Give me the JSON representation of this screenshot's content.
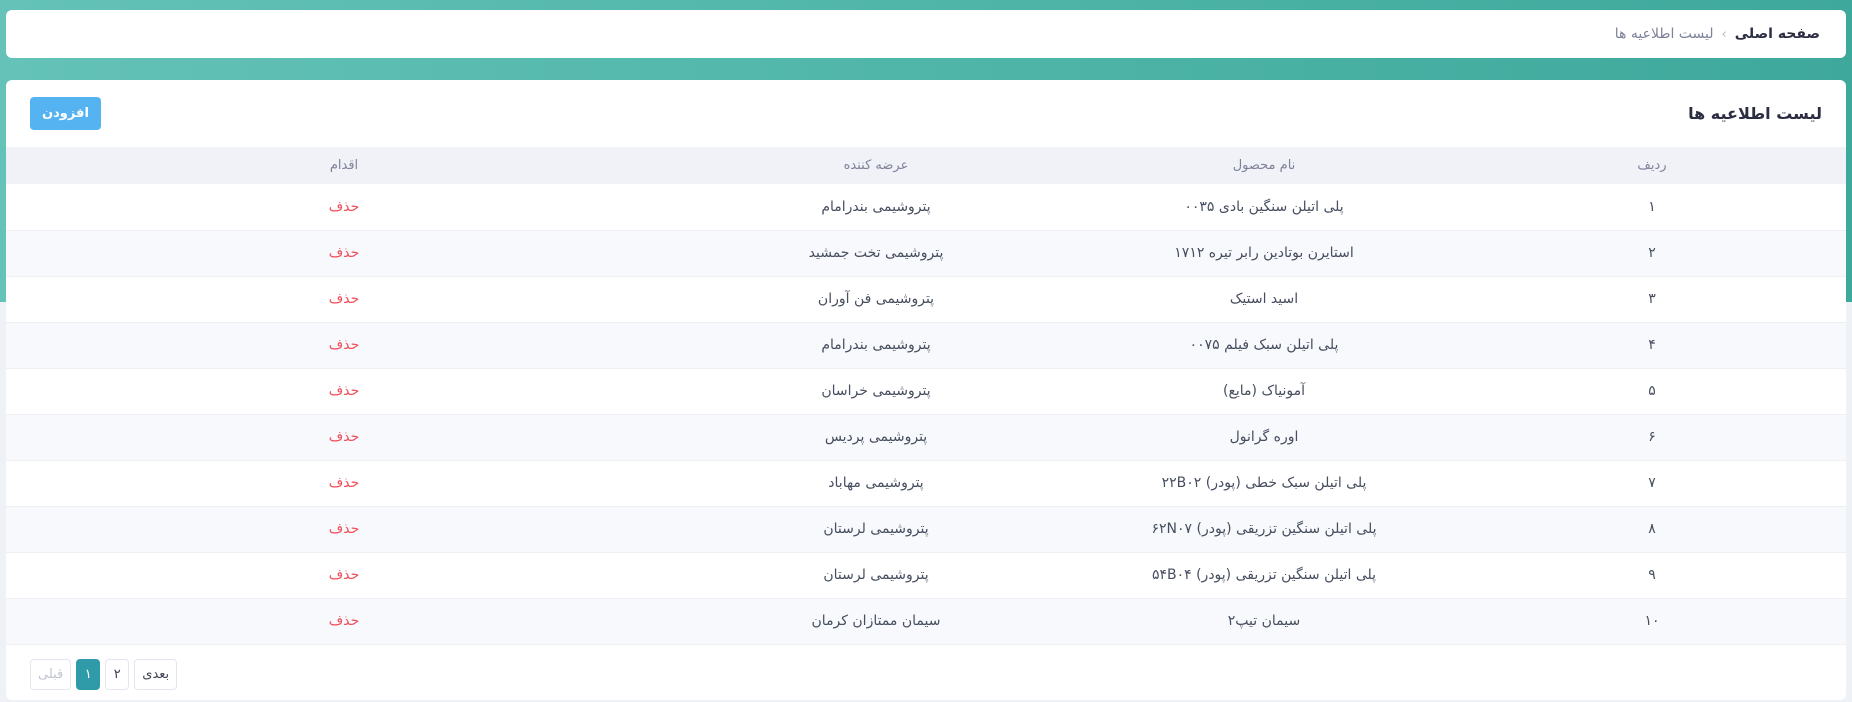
{
  "breadcrumb": {
    "home": "صفحه اصلی",
    "separator": "›",
    "current": "لیست اطلاعیه ها"
  },
  "card": {
    "title": "لیست اطلاعیه ها",
    "add_label": "افزودن"
  },
  "table": {
    "headers": {
      "index": "ردیف",
      "product": "نام محصول",
      "vendor": "عرضه کننده",
      "action": "اقدام"
    },
    "rows": [
      {
        "index": "۱",
        "product": "پلی اتیلن سنگین بادی ۰۰۳۵",
        "vendor": "پتروشیمی بندرامام",
        "action": "حذف"
      },
      {
        "index": "۲",
        "product": "استایرن بوتادین رابر تیره ۱۷۱۲",
        "vendor": "پتروشیمی تخت جمشید",
        "action": "حذف"
      },
      {
        "index": "۳",
        "product": "اسید استیک",
        "vendor": "پتروشیمی فن آوران",
        "action": "حذف"
      },
      {
        "index": "۴",
        "product": "پلی اتیلن سبک فیلم ۰۰۷۵",
        "vendor": "پتروشیمی بندرامام",
        "action": "حذف"
      },
      {
        "index": "۵",
        "product": "آمونیاک (مایع)",
        "vendor": "پتروشیمی خراسان",
        "action": "حذف"
      },
      {
        "index": "۶",
        "product": "اوره گرانول",
        "vendor": "پتروشیمی پردیس",
        "action": "حذف"
      },
      {
        "index": "۷",
        "product": "پلی اتیلن سبک خطی (پودر) ۲۲B۰۲",
        "vendor": "پتروشیمی مهاباد",
        "action": "حذف"
      },
      {
        "index": "۸",
        "product": "پلی اتیلن سنگین تزریقی (پودر) ۶۲N۰۷",
        "vendor": "پتروشیمی لرستان",
        "action": "حذف"
      },
      {
        "index": "۹",
        "product": "پلی اتیلن سنگین تزریقی (پودر) ۵۴B۰۴",
        "vendor": "پتروشیمی لرستان",
        "action": "حذف"
      },
      {
        "index": "۱۰",
        "product": "سیمان تیپ۲",
        "vendor": "سیمان ممتازان کرمان",
        "action": "حذف"
      }
    ]
  },
  "pagination": {
    "prev_label": "قبلی",
    "current_page": "۱",
    "page_2": "۲",
    "next_label": "بعدی"
  },
  "colors": {
    "header_teal": "#4cb3a6",
    "add_button": "#55b3f2",
    "delete_red": "#f1505b",
    "active_page": "#2f9ba9"
  }
}
